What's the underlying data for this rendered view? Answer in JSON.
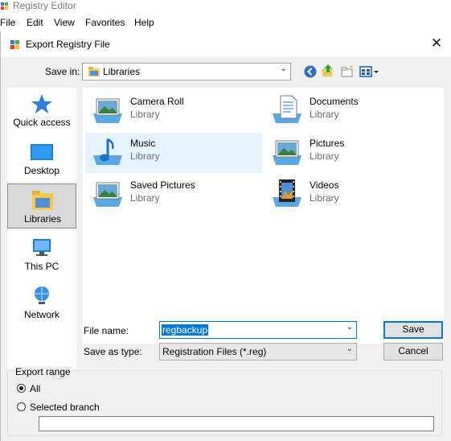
{
  "app": {
    "title": "Registry Editor",
    "menu": [
      "File",
      "Edit",
      "View",
      "Favorites",
      "Help"
    ]
  },
  "dialog": {
    "title": "Export Registry File",
    "close_glyph": "✕",
    "save_in_label": "Save in:",
    "save_in_value": "Libraries",
    "places": [
      {
        "label": "Quick access",
        "icon": "star-icon"
      },
      {
        "label": "Desktop",
        "icon": "desktop-icon"
      },
      {
        "label": "Libraries",
        "icon": "libraries-icon"
      },
      {
        "label": "This PC",
        "icon": "computer-icon"
      },
      {
        "label": "Network",
        "icon": "network-icon"
      }
    ],
    "items": [
      {
        "name": "Camera Roll",
        "type": "Library",
        "icon": "picture-library-icon"
      },
      {
        "name": "Documents",
        "type": "Library",
        "icon": "documents-library-icon"
      },
      {
        "name": "Music",
        "type": "Library",
        "icon": "music-library-icon"
      },
      {
        "name": "Pictures",
        "type": "Library",
        "icon": "picture-library-icon"
      },
      {
        "name": "Saved Pictures",
        "type": "Library",
        "icon": "picture-library-icon"
      },
      {
        "name": "Videos",
        "type": "Library",
        "icon": "videos-library-icon"
      }
    ],
    "file_name_label": "File name:",
    "file_name_value": "regbackup",
    "save_type_label": "Save as type:",
    "save_type_value": "Registration Files (*.reg)",
    "save_button": "Save",
    "cancel_button": "Cancel",
    "export_range": {
      "legend": "Export range",
      "all_label": "All",
      "branch_label": "Selected branch",
      "branch_value": ""
    },
    "colors": {
      "selection_bg": "#e5f3ff",
      "highlight": "#0078d7",
      "dialog_bg": "#f0f0f0"
    }
  }
}
